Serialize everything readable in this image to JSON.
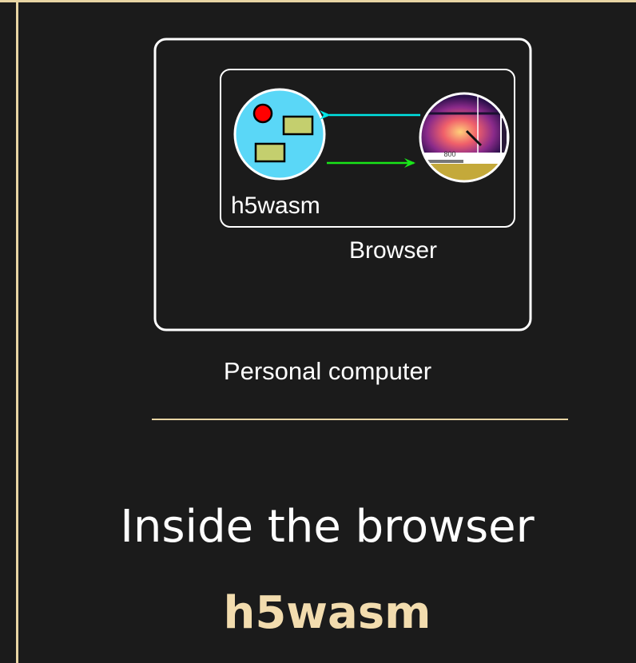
{
  "diagram": {
    "h5wasm_label": "h5wasm",
    "browser_label": "Browser",
    "computer_label": "Personal computer",
    "thumbnail_value": "800"
  },
  "colors": {
    "accent": "#e8d5a4",
    "title_accent": "#f2dcae",
    "background": "#1b1b1b",
    "h5wasm_circle": "#5ad7f7",
    "cyan_arrow": "#00e5e5",
    "green_arrow": "#19e619"
  },
  "slide": {
    "title": "Inside the browser",
    "subtitle": "h5wasm"
  }
}
